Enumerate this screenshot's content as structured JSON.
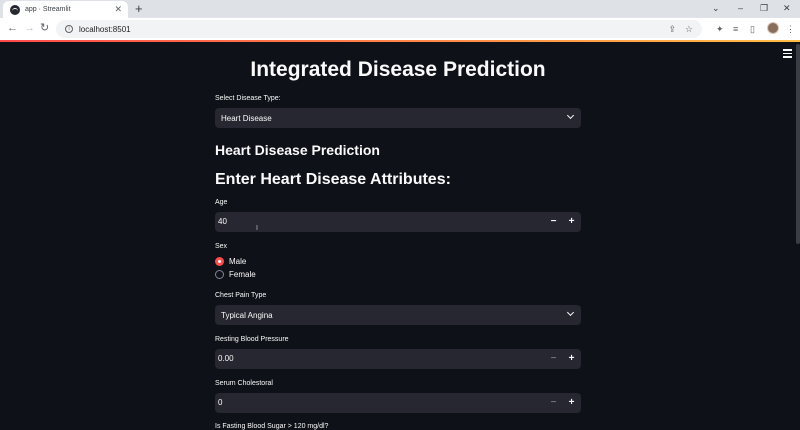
{
  "browser": {
    "tab_title": "app · Streamlit",
    "tab_close": "✕",
    "new_tab": "+",
    "url": "localhost:8501",
    "icons": {
      "back": "←",
      "forward": "→",
      "reload": "↻",
      "info": "i",
      "share": "⇪",
      "star": "☆",
      "extensions": "✦",
      "media": "≡",
      "sidepanel": "▯",
      "menu": "⋮",
      "minimize": "–",
      "maximize": "❐",
      "close": "✕",
      "tab_search": "⌄"
    }
  },
  "app": {
    "title": "Integrated Disease Prediction",
    "disease_select": {
      "label": "Select Disease Type:",
      "value": "Heart Disease"
    },
    "section_header": "Heart Disease Prediction",
    "attributes_header": "Enter Heart Disease Attributes:",
    "age": {
      "label": "Age",
      "value": "40"
    },
    "sex": {
      "label": "Sex",
      "options": [
        "Male",
        "Female"
      ],
      "selected": "Male"
    },
    "chest_pain": {
      "label": "Chest Pain Type",
      "value": "Typical Angina"
    },
    "resting_bp": {
      "label": "Resting Blood Pressure",
      "value": "0.00"
    },
    "cholesterol": {
      "label": "Serum Cholestoral",
      "value": "0"
    },
    "fasting_sugar": {
      "label": "Is Fasting Blood Sugar > 120 mg/dl?"
    },
    "stepper": {
      "minus": "−",
      "plus": "+"
    }
  },
  "colors": {
    "background": "#0e1117",
    "widget": "#262730",
    "accent": "#ff4b4b",
    "text": "#fafafa"
  }
}
